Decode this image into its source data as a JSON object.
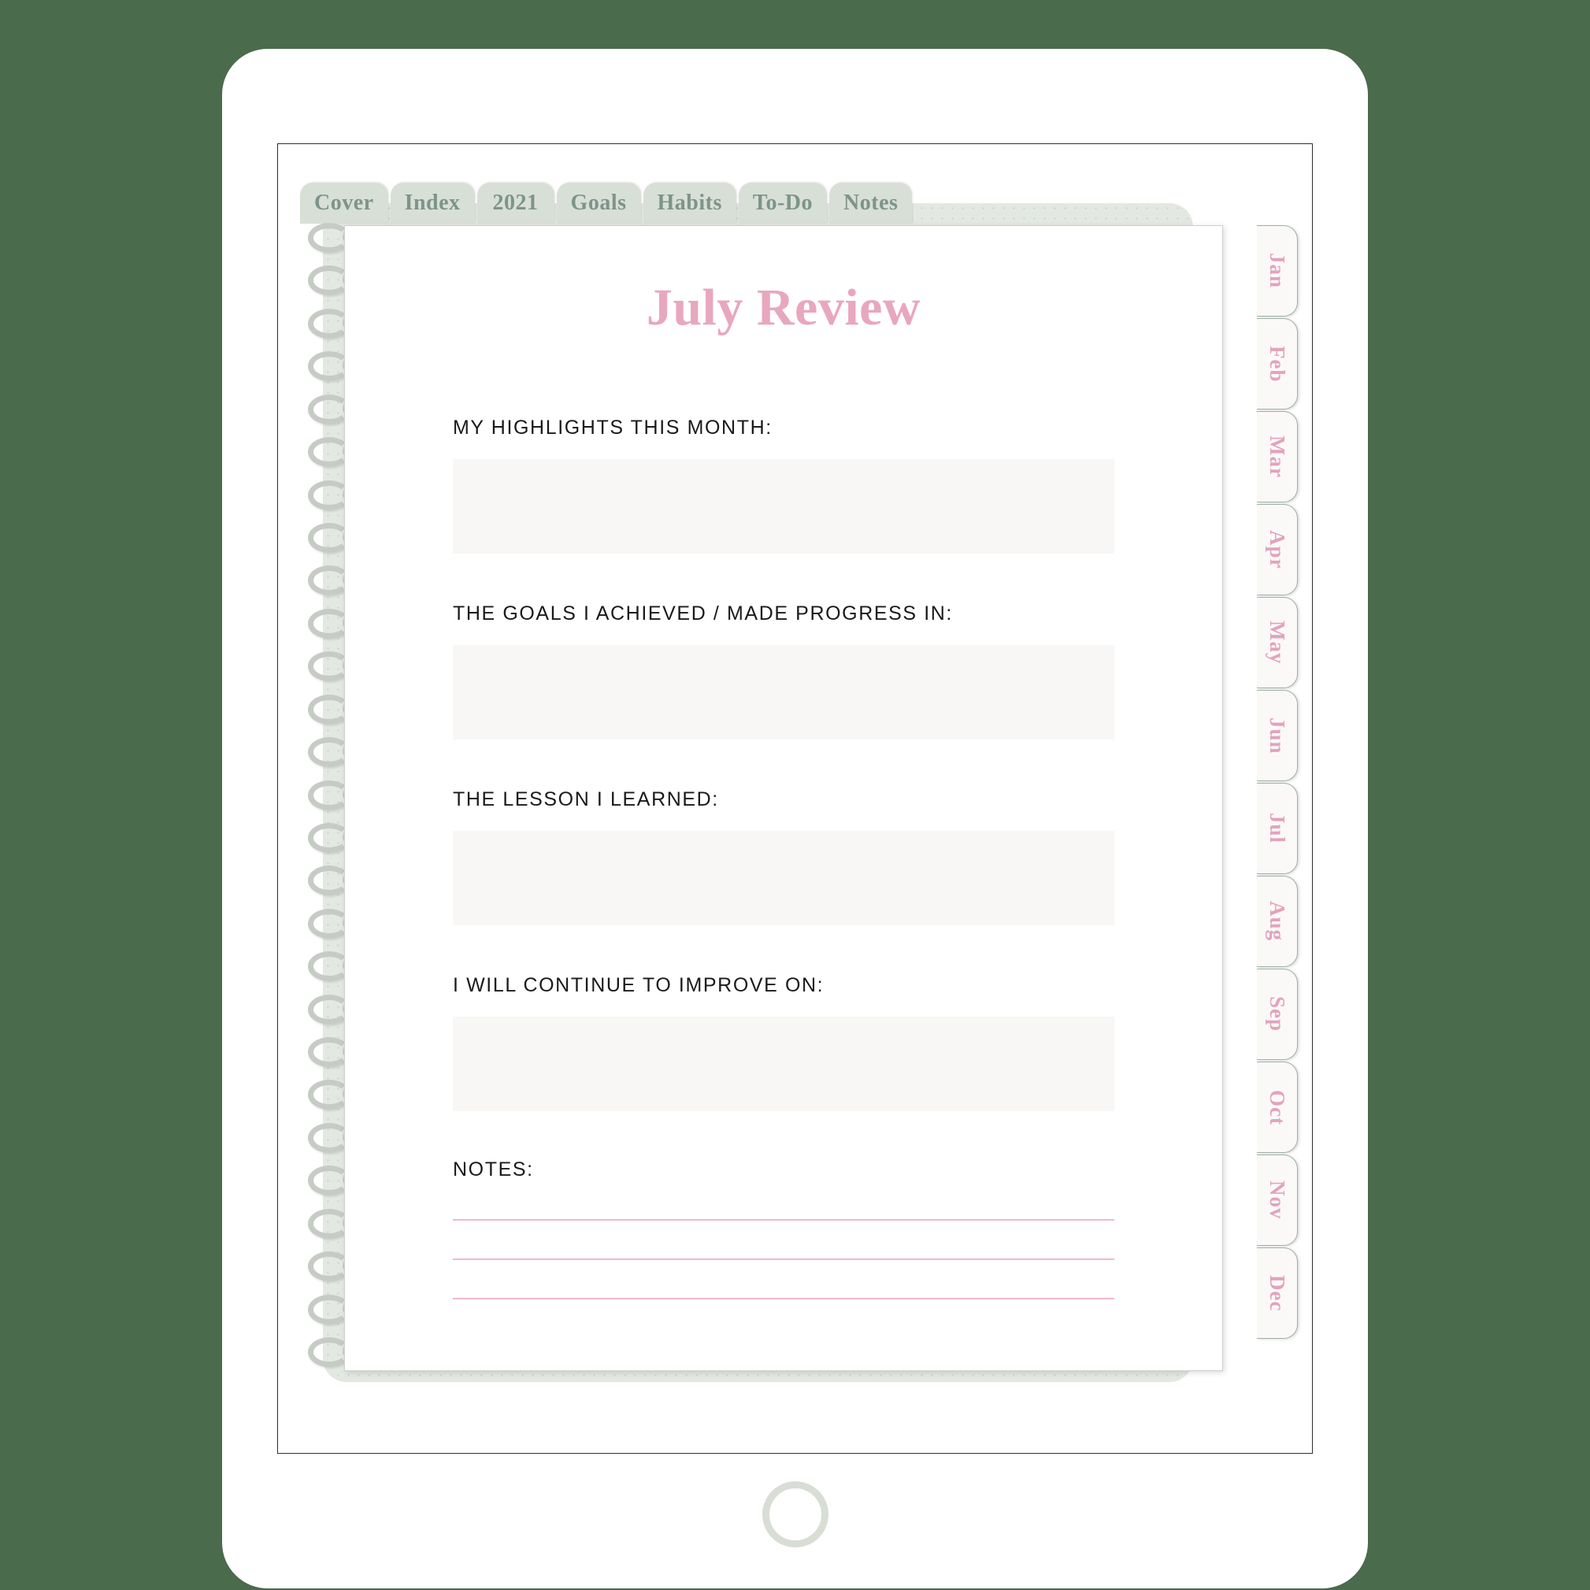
{
  "device": {
    "name": "tablet-device",
    "camera": "front-camera-dot",
    "home_button": "home-button"
  },
  "colors": {
    "background": "#4a6b4c",
    "tab_sage": "#d8dfd7",
    "tab_text": "#7d948a",
    "accent_pink": "#e8a7bf",
    "rule_pink": "#eeb9cb",
    "box_fill": "#f8f7f5",
    "backing_sage": "#e3e9e2"
  },
  "top_tabs": [
    {
      "label": "Cover"
    },
    {
      "label": "Index"
    },
    {
      "label": "2021"
    },
    {
      "label": "Goals"
    },
    {
      "label": "Habits"
    },
    {
      "label": "To-Do"
    },
    {
      "label": "Notes"
    }
  ],
  "month_tabs": [
    {
      "label": "Jan"
    },
    {
      "label": "Feb"
    },
    {
      "label": "Mar"
    },
    {
      "label": "Apr"
    },
    {
      "label": "May"
    },
    {
      "label": "Jun"
    },
    {
      "label": "Jul"
    },
    {
      "label": "Aug"
    },
    {
      "label": "Sep"
    },
    {
      "label": "Oct"
    },
    {
      "label": "Nov"
    },
    {
      "label": "Dec"
    }
  ],
  "page": {
    "title": "July Review",
    "sections": [
      {
        "label": "MY HIGHLIGHTS THIS MONTH:",
        "value": ""
      },
      {
        "label": "THE GOALS I ACHIEVED / MADE PROGRESS IN:",
        "value": ""
      },
      {
        "label": "THE LESSON I LEARNED:",
        "value": ""
      },
      {
        "label": "I WILL CONTINUE TO IMPROVE ON:",
        "value": ""
      }
    ],
    "notes": {
      "label": "NOTES:",
      "lines": [
        "",
        "",
        ""
      ]
    }
  }
}
